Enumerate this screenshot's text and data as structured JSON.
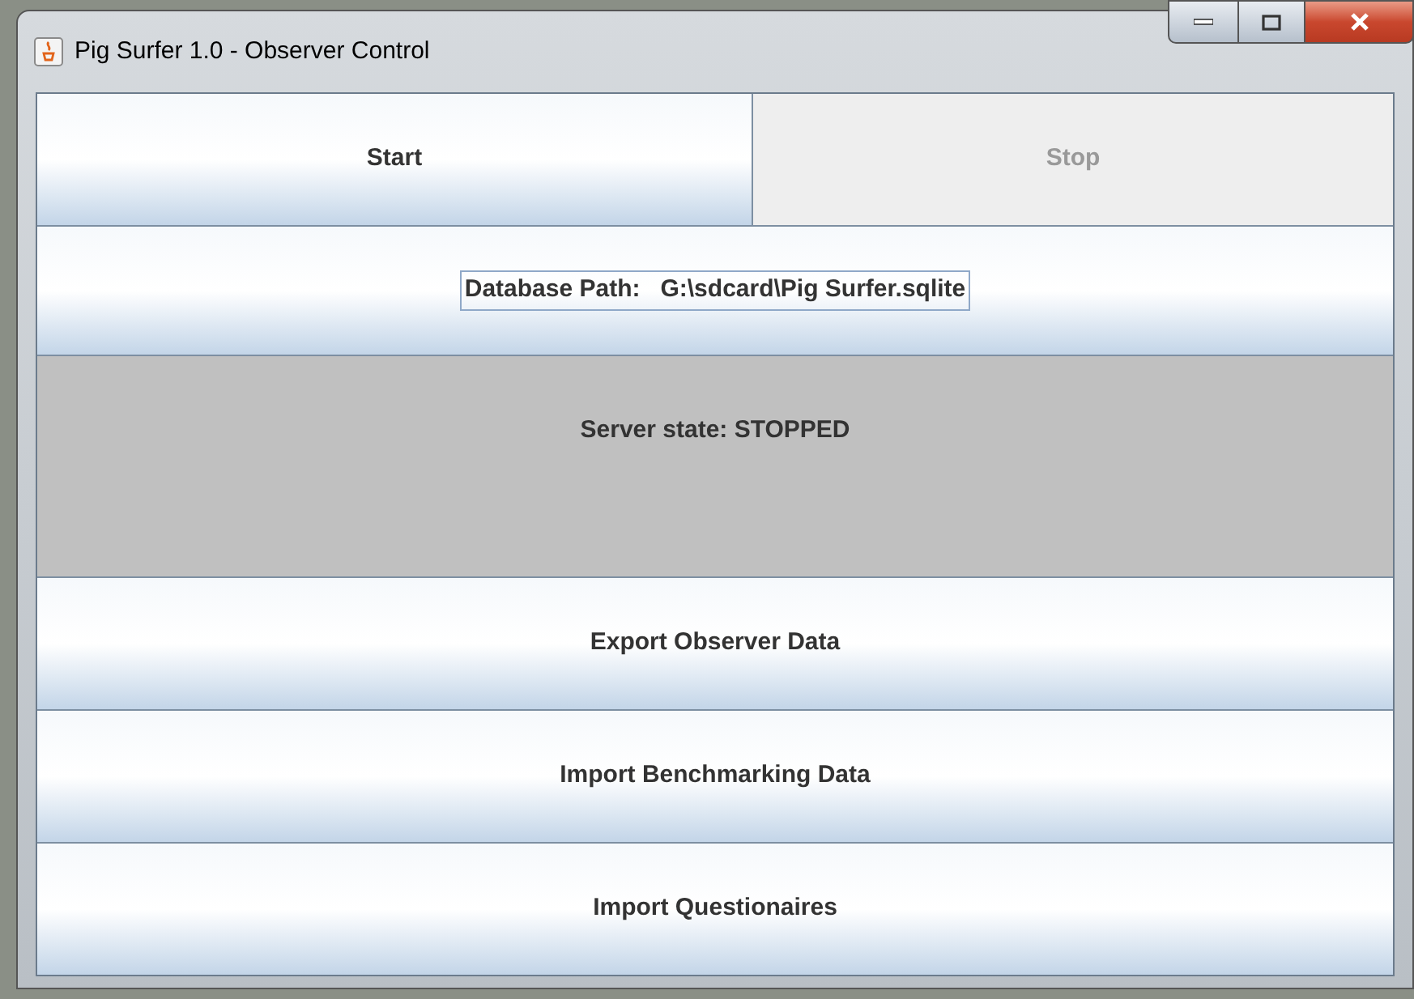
{
  "window": {
    "title": "Pig Surfer 1.0 - Observer Control"
  },
  "controls": [
    {
      "label": "Start",
      "disabled": false
    },
    {
      "label": "Stop",
      "disabled": true
    }
  ],
  "database_button": {
    "label": "Database Path:   G:\\sdcard\\Pig Surfer.sqlite",
    "focused": true
  },
  "server_state": "Server state: STOPPED",
  "actions": [
    {
      "label": "Export Observer Data"
    },
    {
      "label": "Import Benchmarking Data"
    },
    {
      "label": "Import Questionaires"
    }
  ]
}
